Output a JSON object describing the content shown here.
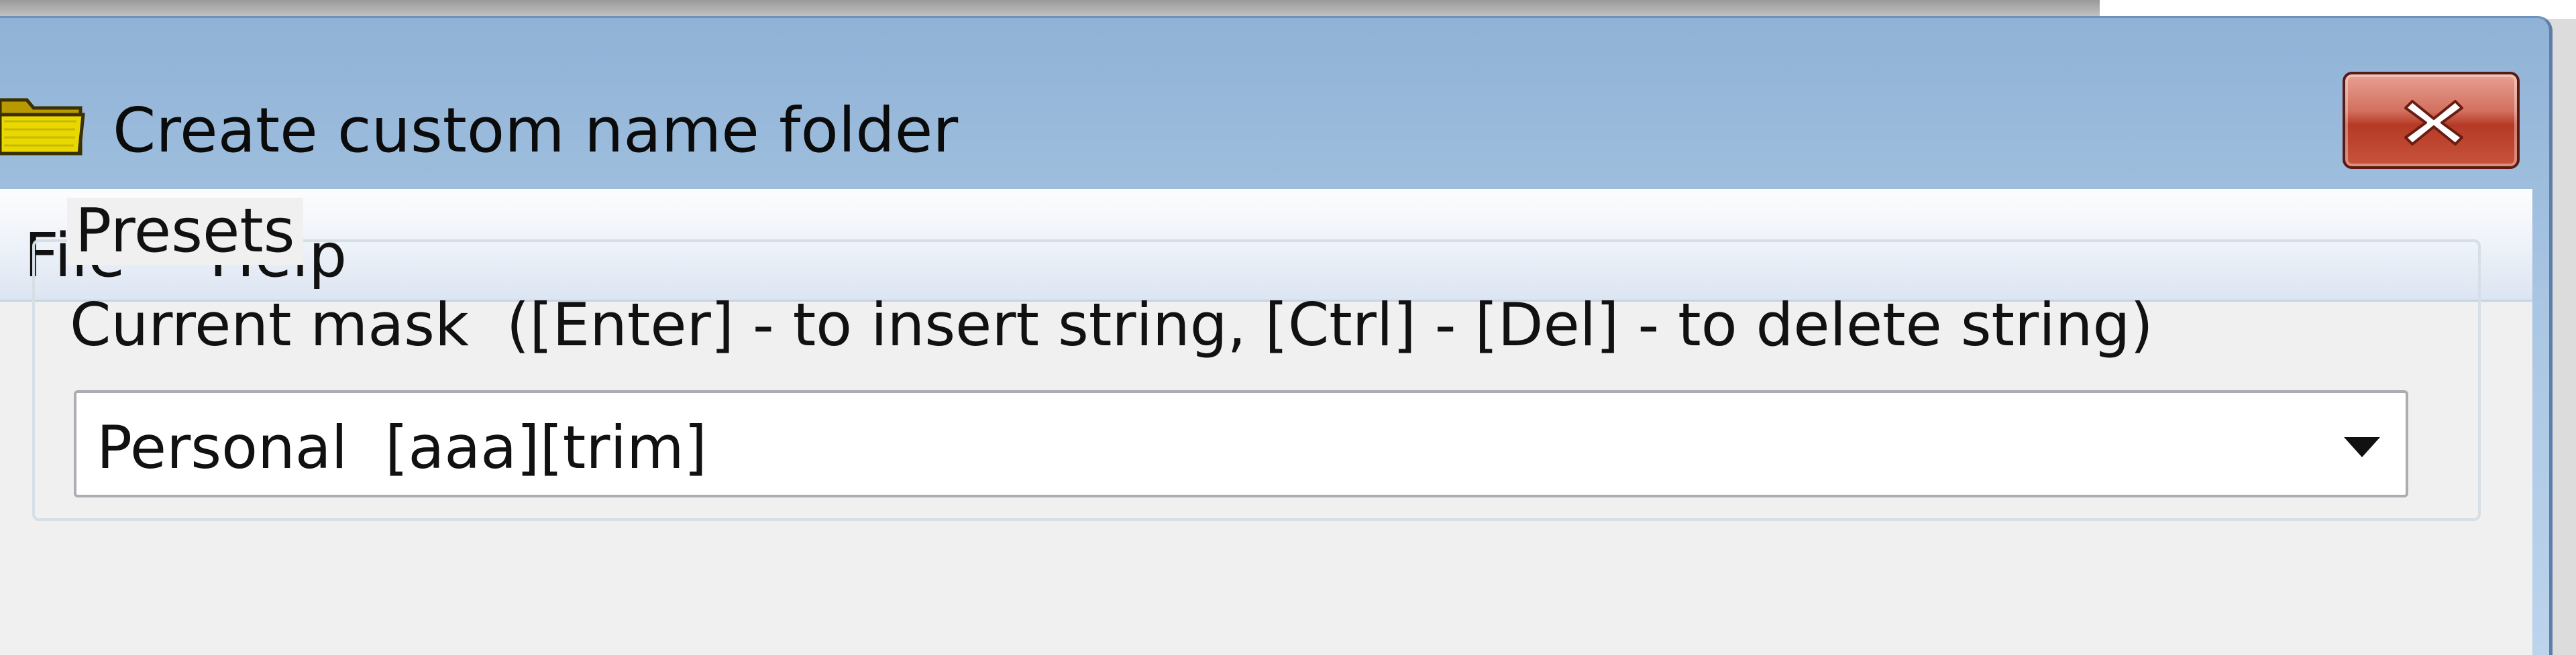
{
  "window": {
    "title": "Create custom name folder",
    "title_icon": "folder-icon",
    "close_icon": "close-icon"
  },
  "menu": {
    "file_label": "File",
    "help_label": "Help"
  },
  "presets": {
    "legend": "Presets",
    "mask_label": "Current mask  ([Enter] - to insert string, [Ctrl] - [Del] - to delete string)",
    "mask_value": "Personal  [aaa][trim]",
    "dropdown_icon": "chevron-down-icon"
  },
  "colors": {
    "titlebar": "#a9c6e3",
    "close_button": "#c8543c",
    "client_background": "#f0f0f0"
  }
}
